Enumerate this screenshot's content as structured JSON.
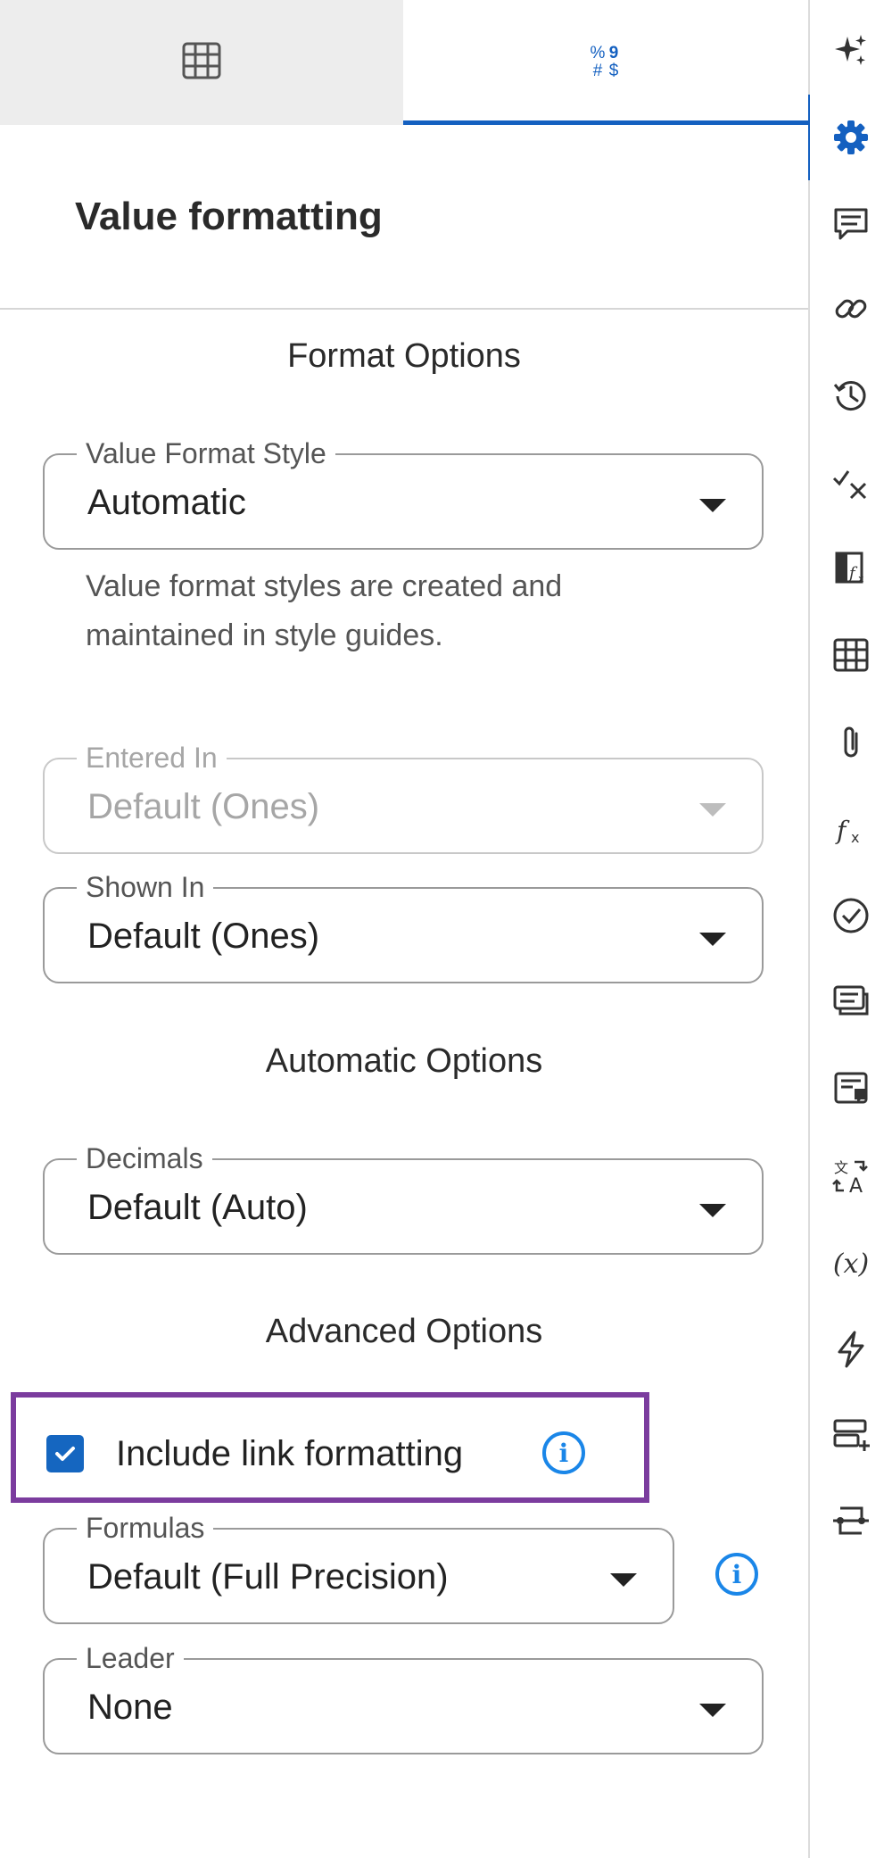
{
  "tabs": {
    "grid_icon": "grid-icon",
    "format_glyph": [
      "%",
      "9",
      "#",
      "$"
    ]
  },
  "panel": {
    "title": "Value formatting",
    "format_options": {
      "heading": "Format Options",
      "value_format_style": {
        "label": "Value Format Style",
        "value": "Automatic"
      },
      "helper": "Value format styles are created and maintained in style guides.",
      "entered_in": {
        "label": "Entered In",
        "value": "Default (Ones)",
        "disabled": true
      },
      "shown_in": {
        "label": "Shown In",
        "value": "Default (Ones)"
      }
    },
    "automatic_options": {
      "heading": "Automatic Options",
      "decimals": {
        "label": "Decimals",
        "value": "Default (Auto)"
      }
    },
    "advanced_options": {
      "heading": "Advanced Options",
      "include_link_formatting": {
        "label": "Include link formatting",
        "checked": true
      },
      "formulas": {
        "label": "Formulas",
        "value": "Default (Full Precision)"
      },
      "leader": {
        "label": "Leader",
        "value": "None"
      }
    }
  },
  "rail": {
    "icons": [
      "sparkle-icon",
      "gear-icon",
      "comment-icon",
      "link-icon",
      "history-icon",
      "check-x-icon",
      "sheet-formula-icon",
      "table-icon",
      "paperclip-icon",
      "fx-icon",
      "check-circle-icon",
      "stacked-cards-icon",
      "document-comment-icon",
      "translate-icon",
      "variable-icon",
      "lightning-icon",
      "rows-add-icon",
      "split-icon"
    ],
    "variable_text": "(x)"
  },
  "colors": {
    "accent": "#1460c0",
    "info": "#1a86e8",
    "highlight": "#7b3c9e"
  }
}
